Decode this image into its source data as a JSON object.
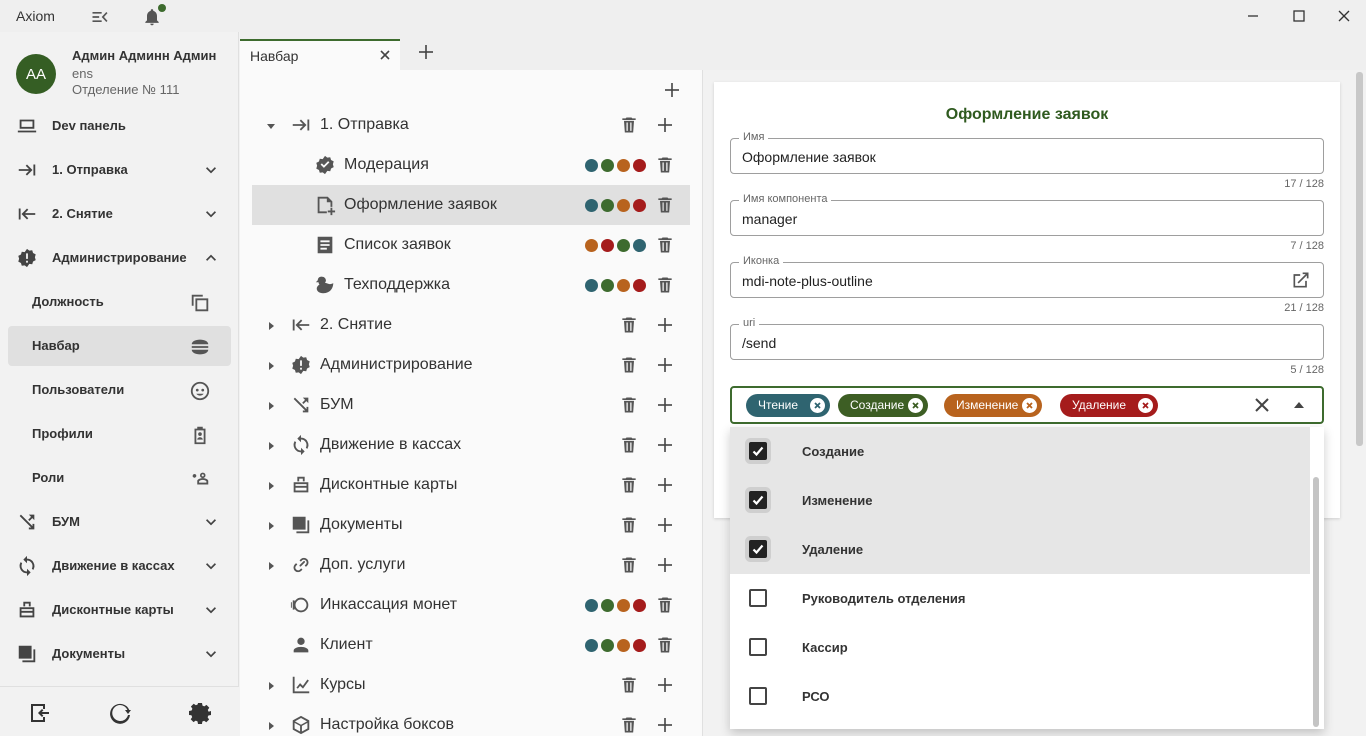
{
  "app": {
    "title": "Axiom"
  },
  "window_controls": {
    "minimize": "minimize-icon",
    "maximize": "maximize-icon",
    "close": "close-icon"
  },
  "user": {
    "initials": "АА",
    "name": "Админ Админн Админ",
    "login": "ens",
    "department": "Отделение № 111"
  },
  "sidebar": {
    "items": [
      {
        "label": "Dev панель",
        "icon": "laptop-icon"
      },
      {
        "label": "1. Отправка",
        "icon": "arrow-right-bar-icon",
        "expandable": true
      },
      {
        "label": "2. Снятие",
        "icon": "arrow-left-bar-icon",
        "expandable": true
      },
      {
        "label": "Администрирование",
        "icon": "alert-badge-icon",
        "expandable": true,
        "expanded": true
      },
      {
        "label": "Должность",
        "icon": "copy-icon",
        "sub": true
      },
      {
        "label": "Навбар",
        "icon": "hamburger-icon",
        "sub": true,
        "active": true
      },
      {
        "label": "Пользователи",
        "icon": "face-icon",
        "sub": true
      },
      {
        "label": "Профили",
        "icon": "clipboard-account-icon",
        "sub": true
      },
      {
        "label": "Роли",
        "icon": "account-key-icon",
        "sub": true
      },
      {
        "label": "БУМ",
        "icon": "shuffle-icon",
        "expandable": true
      },
      {
        "label": "Движение в кассах",
        "icon": "sync-icon",
        "expandable": true
      },
      {
        "label": "Дисконтные карты",
        "icon": "card-icon",
        "expandable": true
      },
      {
        "label": "Документы",
        "icon": "documents-icon",
        "expandable": true
      }
    ],
    "footer": [
      "logout-icon",
      "refresh-icon",
      "settings-icon"
    ]
  },
  "tabs": [
    {
      "label": "Навбар"
    }
  ],
  "tree": {
    "rows": [
      {
        "label": "1. Отправка",
        "icon": "arrow-right-bar-icon",
        "level": 0,
        "expanded": true,
        "actions": "folder"
      },
      {
        "label": "Модерация",
        "icon": "check-decagram-icon",
        "level": 1,
        "roles": [
          "#2f6470",
          "#3d6b2e",
          "#b8631e",
          "#a51c1c"
        ]
      },
      {
        "label": "Оформление заявок",
        "icon": "note-plus-outline-icon",
        "level": 1,
        "selected": true,
        "roles": [
          "#2f6470",
          "#3d6b2e",
          "#b8631e",
          "#a51c1c"
        ]
      },
      {
        "label": "Список заявок",
        "icon": "text-box-icon",
        "level": 1,
        "roles": [
          "#b8631e",
          "#a51c1c",
          "#3d6b2e",
          "#2f6470"
        ]
      },
      {
        "label": "Техподдержка",
        "icon": "duck-icon",
        "level": 1,
        "roles": [
          "#2f6470",
          "#3d6b2e",
          "#b8631e",
          "#a51c1c"
        ]
      },
      {
        "label": "2. Снятие",
        "icon": "arrow-left-bar-icon",
        "level": 0,
        "actions": "folder"
      },
      {
        "label": "Администрирование",
        "icon": "alert-badge-icon",
        "level": 0,
        "actions": "folder"
      },
      {
        "label": "БУМ",
        "icon": "shuffle-icon",
        "level": 0,
        "actions": "folder"
      },
      {
        "label": "Движение в кассах",
        "icon": "sync-icon",
        "level": 0,
        "actions": "folder"
      },
      {
        "label": "Дисконтные карты",
        "icon": "card-icon",
        "level": 0,
        "actions": "folder"
      },
      {
        "label": "Документы",
        "icon": "documents-icon",
        "level": 0,
        "actions": "folder"
      },
      {
        "label": "Доп. услуги",
        "icon": "link-icon",
        "level": 0,
        "actions": "folder"
      },
      {
        "label": "Инкассация монет",
        "icon": "coins-icon",
        "level": 0,
        "noCaret": true,
        "roles": [
          "#2f6470",
          "#3d6b2e",
          "#b8631e",
          "#a51c1c"
        ]
      },
      {
        "label": "Клиент",
        "icon": "account-icon",
        "level": 0,
        "noCaret": true,
        "roles": [
          "#2f6470",
          "#3d6b2e",
          "#b8631e",
          "#a51c1c"
        ]
      },
      {
        "label": "Курсы",
        "icon": "chart-line-icon",
        "level": 0,
        "actions": "folder"
      },
      {
        "label": "Настройка боксов",
        "icon": "cube-icon",
        "level": 0,
        "actions": "folder"
      }
    ]
  },
  "form": {
    "title": "Оформление заявок",
    "fields": [
      {
        "label": "Имя",
        "value": "Оформление заявок",
        "counter": "17 / 128"
      },
      {
        "label": "Имя компонента",
        "value": "manager",
        "counter": "7 / 128"
      },
      {
        "label": "Иконка",
        "value": "mdi-note-plus-outline",
        "counter": "21 / 128",
        "action_icon": "open-in-new-icon"
      },
      {
        "label": "uri",
        "value": "/send",
        "counter": "5 / 128"
      }
    ],
    "chips": [
      {
        "label": "Чтение",
        "color": "#2f6470"
      },
      {
        "label": "Создание",
        "color": "#3d5e24"
      },
      {
        "label": "Изменение",
        "color": "#b8631e"
      },
      {
        "label": "Удаление",
        "color": "#a51c1c"
      }
    ]
  },
  "dropdown": {
    "options": [
      {
        "label": "Создание",
        "checked": true
      },
      {
        "label": "Изменение",
        "checked": true
      },
      {
        "label": "Удаление",
        "checked": true
      },
      {
        "label": "Руководитель отделения",
        "checked": false
      },
      {
        "label": "Кассир",
        "checked": false
      },
      {
        "label": "РСО",
        "checked": false
      }
    ]
  }
}
